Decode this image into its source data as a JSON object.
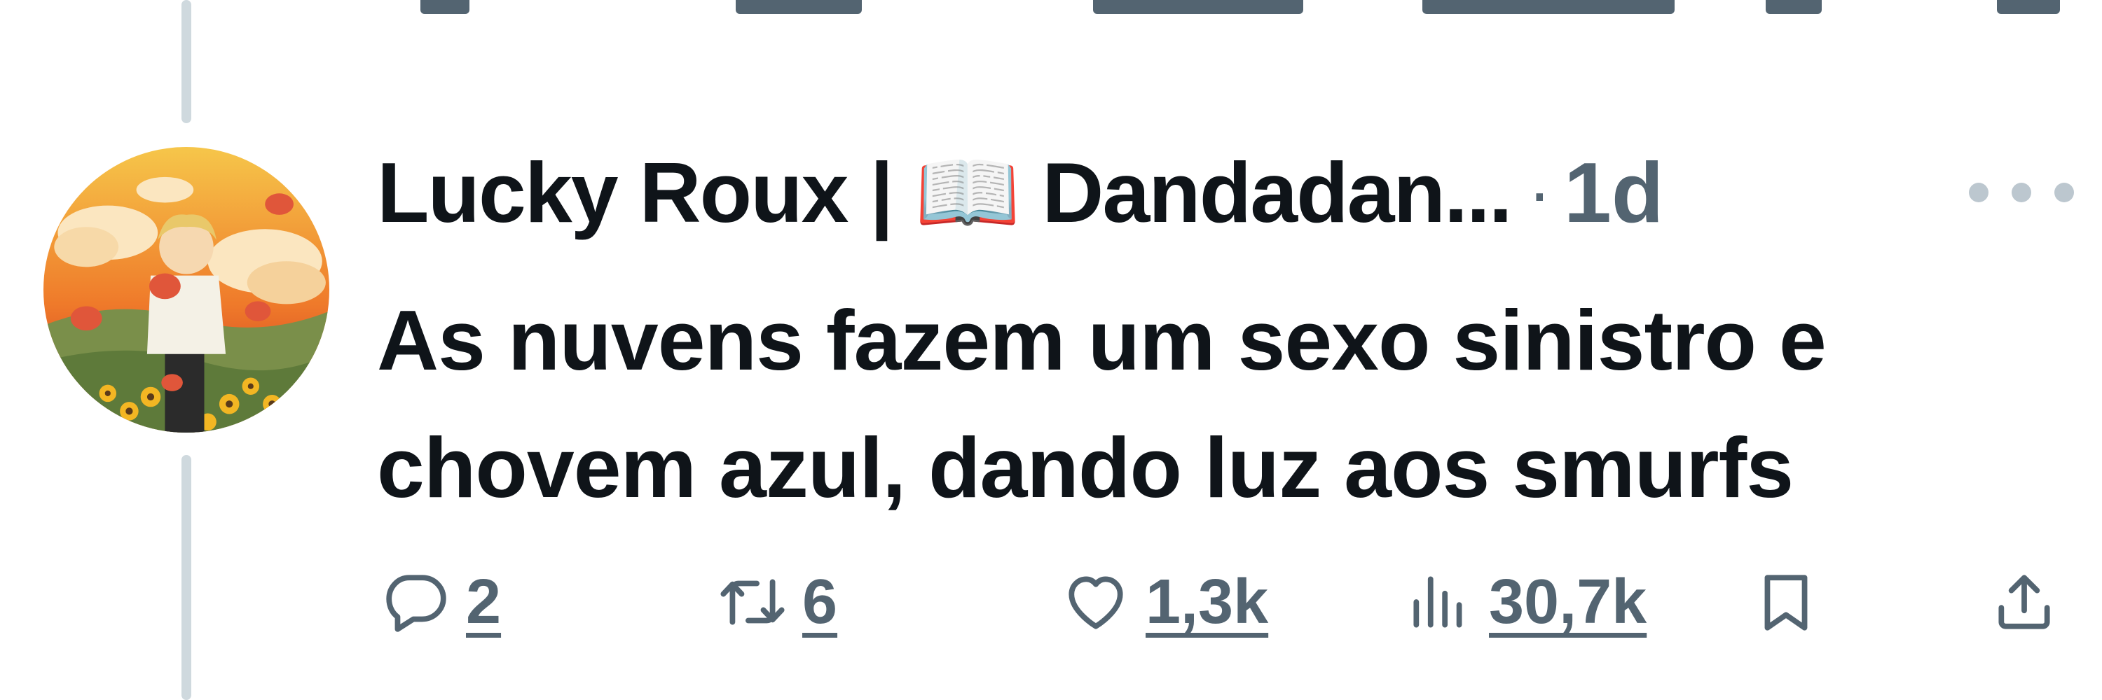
{
  "tweet": {
    "author_display_name": "Lucky Roux | 📖 Dandadan...",
    "separator": "·",
    "timestamp": "1d",
    "text_lines": [
      "As nuvens fazem um sexo sinistro e",
      "chovem azul, dando luz aos smurfs"
    ]
  },
  "actions": {
    "reply": {
      "icon": "reply-icon",
      "count": "2"
    },
    "retweet": {
      "icon": "retweet-icon",
      "count": "6"
    },
    "like": {
      "icon": "heart-icon",
      "count": "1,3k"
    },
    "views": {
      "icon": "views-bar-chart-icon",
      "count": "30,7k"
    },
    "bookmark": {
      "icon": "bookmark-icon"
    },
    "share": {
      "icon": "share-icon"
    }
  },
  "more_menu": {
    "icon": "more-dots-icon"
  },
  "colors": {
    "text_primary": "#0f1419",
    "text_secondary": "#536471",
    "thread_line": "#cfd9de"
  }
}
